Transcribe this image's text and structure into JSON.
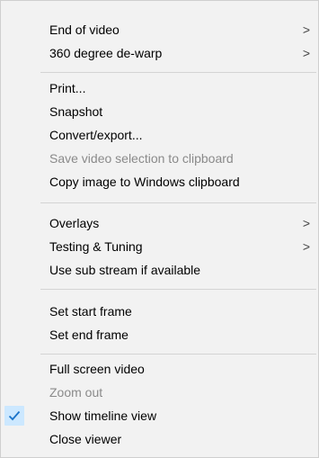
{
  "menu": {
    "items": [
      {
        "label": "End of video",
        "arrow": ">"
      },
      {
        "label": "360 degree de-warp",
        "arrow": ">"
      },
      {
        "label": "Print..."
      },
      {
        "label": "Snapshot"
      },
      {
        "label": "Convert/export..."
      },
      {
        "label": "Save video selection to clipboard"
      },
      {
        "label": "Copy image to Windows clipboard"
      },
      {
        "label": "Overlays",
        "arrow": ">"
      },
      {
        "label": "Testing & Tuning",
        "arrow": ">"
      },
      {
        "label": "Use sub stream if available"
      },
      {
        "label": "Set start frame"
      },
      {
        "label": "Set end frame"
      },
      {
        "label": "Full screen video"
      },
      {
        "label": "Zoom out"
      },
      {
        "label": "Show timeline view"
      },
      {
        "label": "Close viewer"
      }
    ]
  },
  "colors": {
    "menu_background": "#f2f2f2",
    "disabled_text": "#8a8a8a",
    "check_highlight": "#cce8ff",
    "check_mark": "#1a73c9",
    "separator": "#d4d4d4"
  }
}
